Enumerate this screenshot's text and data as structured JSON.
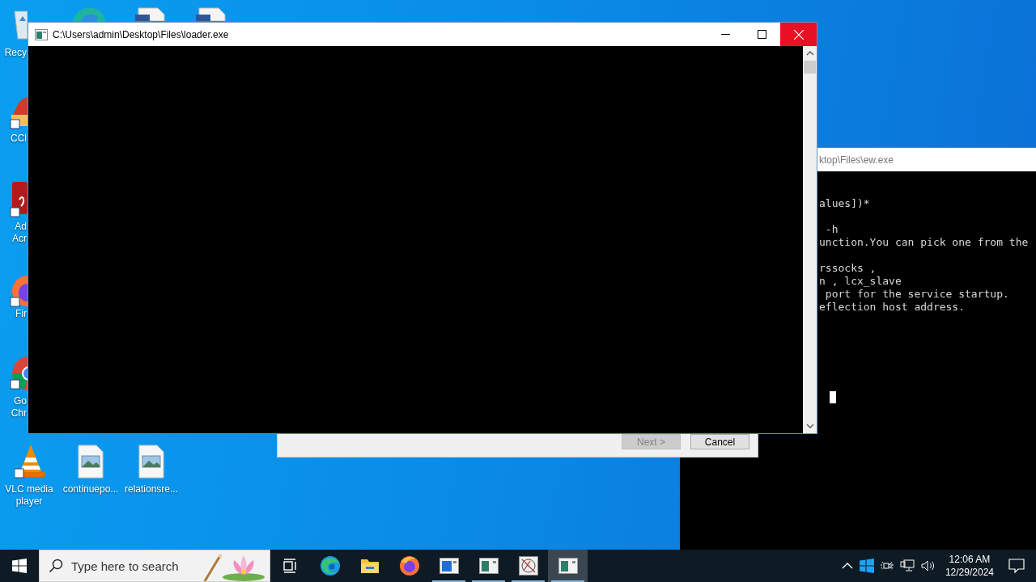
{
  "desktop": {
    "icons": [
      {
        "kind": "recycle-bin",
        "label_lines": [
          "Recy"
        ]
      },
      {
        "kind": "ccleaner",
        "label_lines": [
          "CCl"
        ]
      },
      {
        "kind": "acrobat",
        "label_lines": [
          "Ad",
          "Acr"
        ]
      },
      {
        "kind": "firefox",
        "label_lines": [
          "Fir"
        ]
      },
      {
        "kind": "chrome",
        "label_lines": [
          "Go",
          "Chr"
        ]
      },
      {
        "kind": "vlc",
        "label_lines": [
          "VLC media",
          "player"
        ]
      },
      {
        "kind": "image-file",
        "label_lines": [
          "continuepo..."
        ]
      },
      {
        "kind": "image-file",
        "label_lines": [
          "relationsre..."
        ]
      },
      {
        "kind": "edge"
      },
      {
        "kind": "document"
      },
      {
        "kind": "document"
      }
    ]
  },
  "ew_window": {
    "title": "ktop\\Files\\ew.exe",
    "console_blocks": [
      [
        "alues])*"
      ],
      [
        " -h",
        "unction.You can pick one from the"
      ],
      [
        "rssocks ,",
        "n , lcx_slave",
        " port for the service startup.",
        "eflection host address."
      ]
    ],
    "cursor": true
  },
  "wizard": {
    "buttons": [
      {
        "label": "Next >",
        "disabled": true
      },
      {
        "label": "Cancel",
        "disabled": false
      }
    ]
  },
  "loader_window": {
    "title": "C:\\Users\\admin\\Desktop\\Files\\loader.exe"
  },
  "taskbar": {
    "search": {
      "placeholder": "Type here to search"
    },
    "apps": [
      {
        "kind": "task-view",
        "running": false,
        "selected": false
      },
      {
        "kind": "edge",
        "running": false,
        "selected": false
      },
      {
        "kind": "explorer",
        "running": false,
        "selected": false
      },
      {
        "kind": "firefox",
        "running": false,
        "selected": false
      },
      {
        "kind": "window-blue",
        "running": true,
        "selected": false
      },
      {
        "kind": "window-green",
        "running": true,
        "selected": false
      },
      {
        "kind": "sketch",
        "running": true,
        "selected": false
      },
      {
        "kind": "window-green",
        "running": true,
        "selected": true
      }
    ],
    "tray": {
      "time": "12:06 AM",
      "date": "12/29/2024"
    }
  }
}
